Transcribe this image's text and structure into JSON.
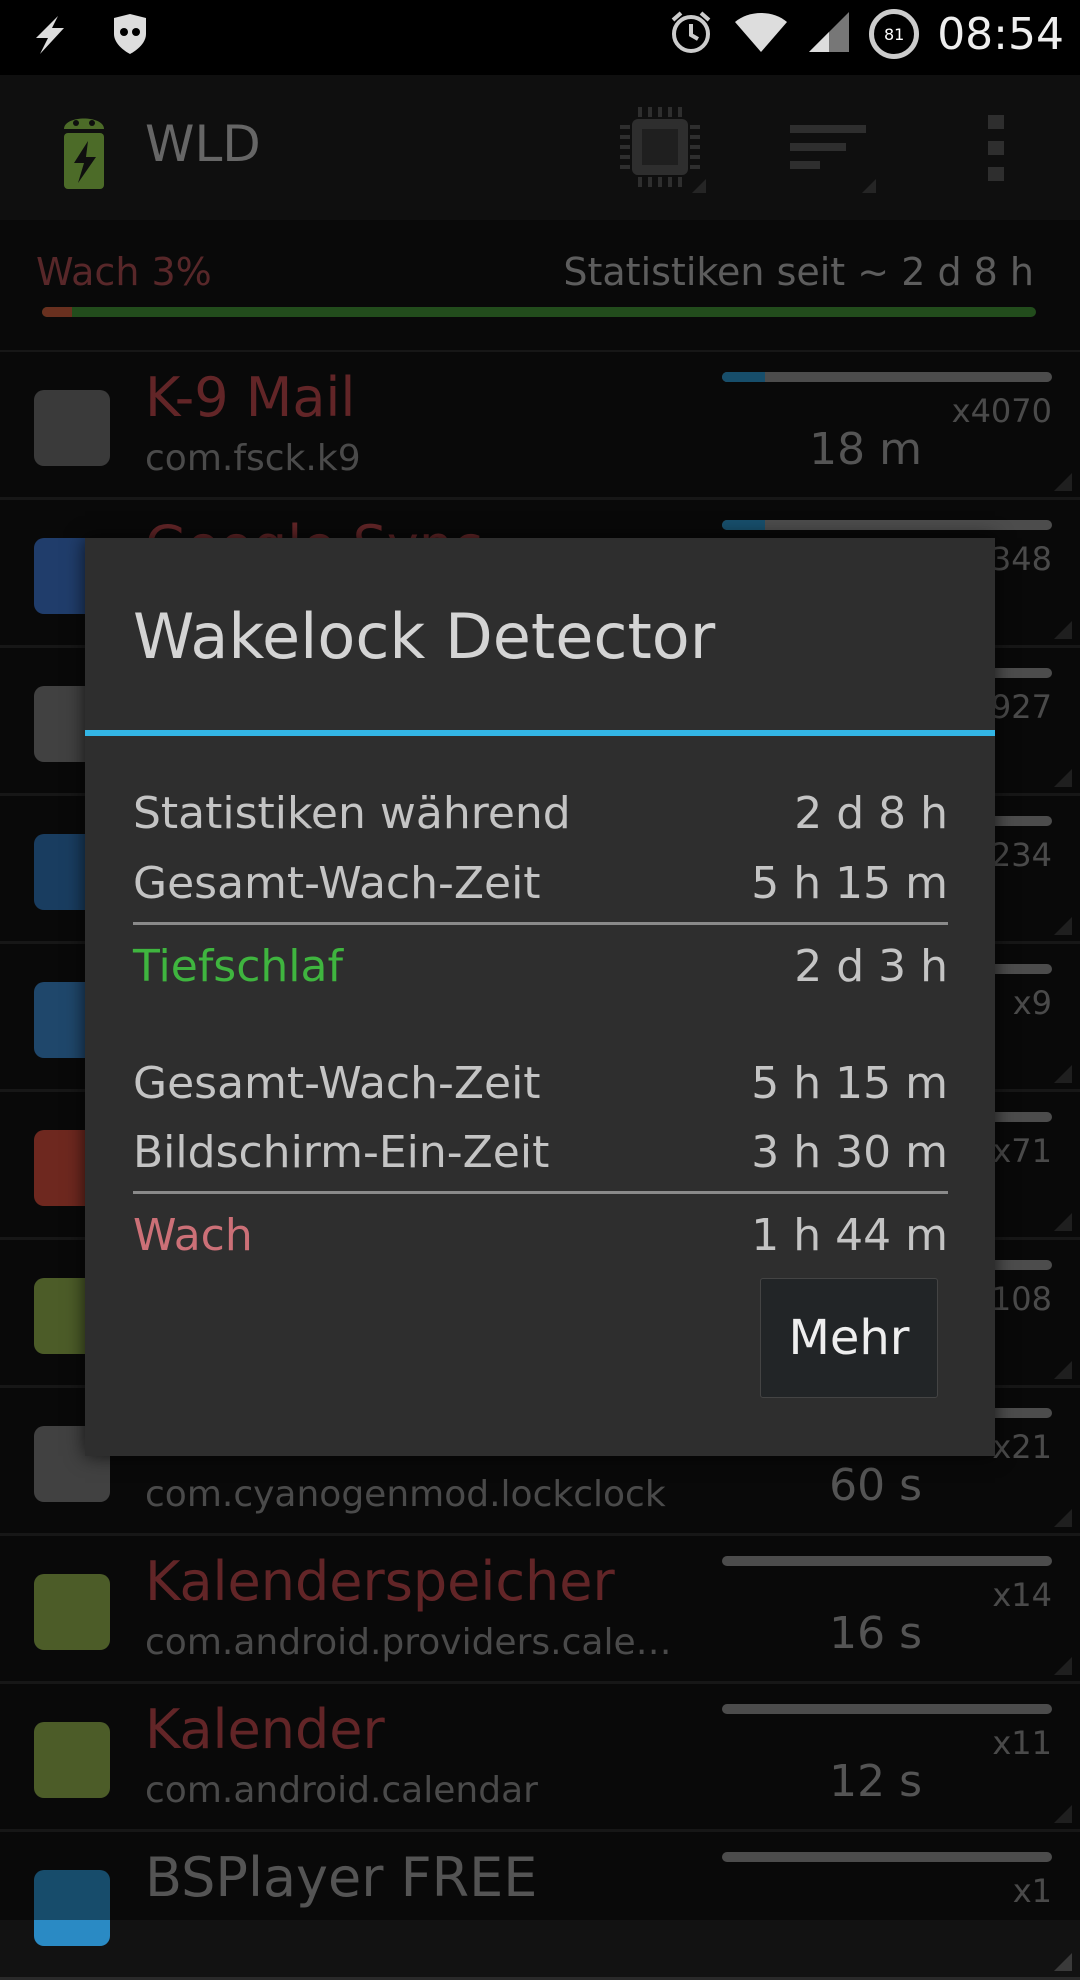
{
  "status_bar": {
    "time": "08:54",
    "battery_level": "81",
    "icons": [
      "flash-icon",
      "guard-icon",
      "alarm-icon",
      "wifi-icon",
      "signal-icon",
      "battery-icon"
    ]
  },
  "action_bar": {
    "title": "WLD",
    "icons": [
      "cpu-icon",
      "sort-icon",
      "overflow-menu-icon"
    ]
  },
  "summary": {
    "wake_label": "Wach 3%",
    "since_label": "Statistiken seit ~ 2 d 8 h",
    "awake_fraction": 0.03
  },
  "list": [
    {
      "name": "K-9 Mail",
      "pkg": "com.fsck.k9",
      "count": "x4070",
      "duration": "18 m",
      "name_color": "#b34448",
      "bar": 0.13
    },
    {
      "name": "Google Sync",
      "pkg": "",
      "count": "x348",
      "duration": "",
      "name_color": "#b34448",
      "bar": 0.13
    },
    {
      "name": "",
      "pkg": "",
      "count": "x927",
      "duration": "",
      "name_color": "#b34448",
      "bar": 0.0
    },
    {
      "name": "",
      "pkg": "",
      "count": "x234",
      "duration": "",
      "name_color": "#b34448",
      "bar": 0.0
    },
    {
      "name": "",
      "pkg": "",
      "count": "x9",
      "duration": "",
      "name_color": "#b34448",
      "bar": 0.0
    },
    {
      "name": "",
      "pkg": "",
      "count": "x71",
      "duration": "",
      "name_color": "#b34448",
      "bar": 0.0
    },
    {
      "name": "",
      "pkg": "",
      "count": "x108",
      "duration": "",
      "name_color": "#b34448",
      "bar": 0.0
    },
    {
      "name": "",
      "pkg": "com.cyanogenmod.lockclock",
      "count": "x21",
      "duration": "60 s",
      "name_color": "#b34448",
      "bar": 0.0
    },
    {
      "name": "Kalenderspeicher",
      "pkg": "com.android.providers.cale…",
      "count": "x14",
      "duration": "16 s",
      "name_color": "#b34448",
      "bar": 0.0
    },
    {
      "name": "Kalender",
      "pkg": "com.android.calendar",
      "count": "x11",
      "duration": "12 s",
      "name_color": "#b34448",
      "bar": 0.0
    },
    {
      "name": "BSPlayer FREE",
      "pkg": "",
      "count": "x1",
      "duration": "",
      "name_color": "#9a9a9a",
      "bar": 0.0
    }
  ],
  "dialog": {
    "title": "Wakelock Detector",
    "accent": "#33b5e5",
    "stats_during_label": "Statistiken während",
    "stats_during_value": "2 d 8 h",
    "total_awake_label": "Gesamt-Wach-Zeit",
    "total_awake_value": "5 h 15 m",
    "deep_sleep_label": "Tiefschlaf",
    "deep_sleep_value": "2 d 3 h",
    "total_awake_label_2": "Gesamt-Wach-Zeit",
    "total_awake_value_2": "5 h 15 m",
    "screen_on_label": "Bildschirm-Ein-Zeit",
    "screen_on_value": "3 h 30 m",
    "awake_label": "Wach",
    "awake_value": "1 h 44 m",
    "more_button": "Mehr"
  }
}
